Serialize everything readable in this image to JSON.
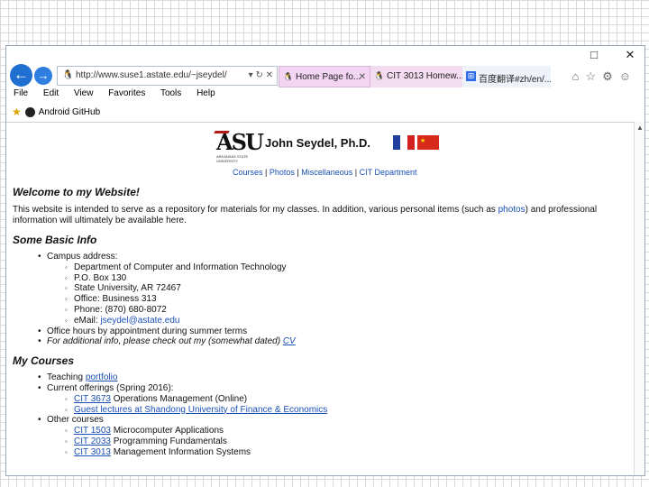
{
  "window": {
    "minimize": "□",
    "close": "✕"
  },
  "address": {
    "url": "http://www.suse1.astate.edu/~jseydel/",
    "tools": "▾ ↻ ✕"
  },
  "tabs": [
    {
      "label": "Home Page fo...",
      "close": "✕"
    },
    {
      "label": "CIT 3013 Homew..."
    },
    {
      "label": "百度翻译#zh/en/..."
    }
  ],
  "menu": [
    "File",
    "Edit",
    "View",
    "Favorites",
    "Tools",
    "Help"
  ],
  "favorites": {
    "item": "Android GitHub"
  },
  "header": {
    "logo_text": "ASU",
    "logo_sub": "ARKANSAS STATE UNIVERSITY",
    "name": "John Seydel, Ph.D.",
    "links": [
      "Courses",
      "Photos",
      "Miscellaneous",
      "CIT Department"
    ],
    "sep": " | "
  },
  "welcome": {
    "title": "Welcome to my Website!",
    "text_before": "This website is intended to serve as a repository for materials for my classes. In addition, various personal items (such as ",
    "link": "photos",
    "text_after": ") and professional information will ultimately be available here."
  },
  "basic": {
    "title": "Some Basic Info",
    "campus_label": "Campus address:",
    "campus": [
      "Department of Computer and Information Technology",
      "P.O. Box 130",
      "State University, AR 72467",
      "Office: Business 313",
      "Phone: (870) 680-8072"
    ],
    "email_label": "eMail: ",
    "email": "jseydel@astate.edu",
    "office_hours": "Office hours by appointment during summer terms",
    "additional_text": "For additional info, please check out my (somewhat dated) ",
    "cv": "CV"
  },
  "courses": {
    "title": "My Courses",
    "teaching_label": "Teaching ",
    "portfolio": "portfolio",
    "current_label": "Current offerings (Spring 2016):",
    "current": [
      {
        "code": "CIT 3673",
        "name": " Operations Management (Online)"
      },
      {
        "code": "",
        "name": "Guest lectures at Shandong University of Finance & Economics",
        "link": true
      }
    ],
    "other_label": "Other courses",
    "other": [
      {
        "code": "CIT 1503",
        "name": " Microcomputer Applications"
      },
      {
        "code": "CIT 2033",
        "name": " Programming Fundamentals"
      },
      {
        "code": "CIT 3013",
        "name": " Management Information Systems"
      }
    ]
  }
}
